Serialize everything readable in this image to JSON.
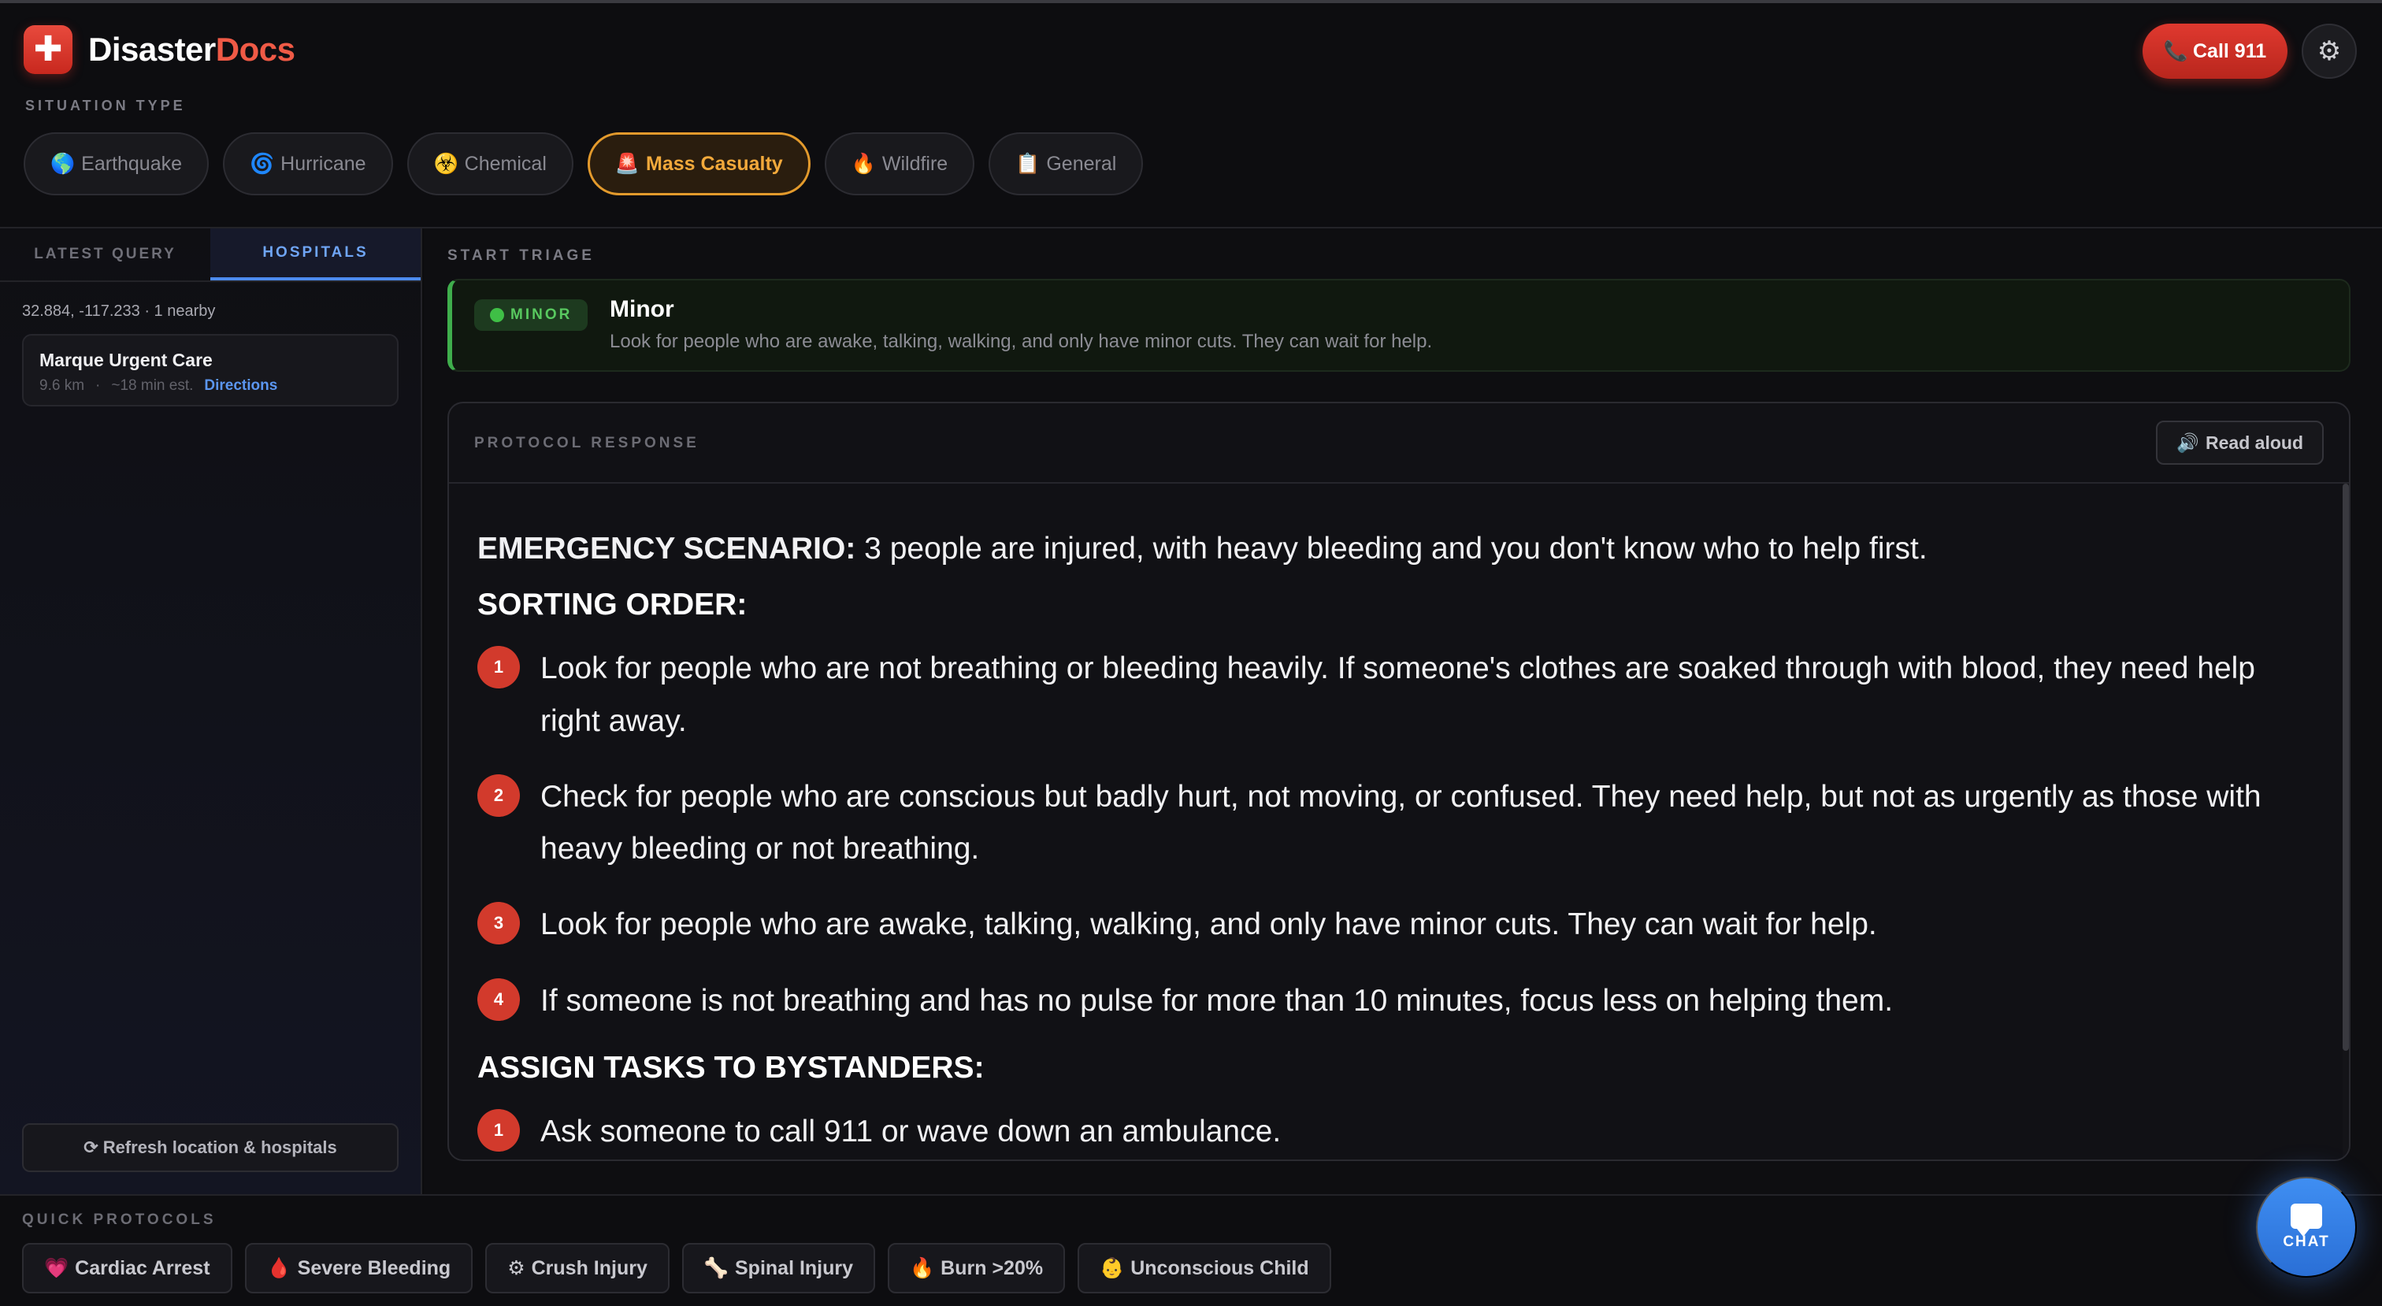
{
  "header": {
    "brand_icon": "✚",
    "brand_part1": "Disaster",
    "brand_part2": "Docs",
    "call_label": "Call 911",
    "call_icon": "📞",
    "settings_icon": "⚙"
  },
  "situation": {
    "label": "SITUATION TYPE",
    "items": [
      {
        "icon": "🌎",
        "label": "Earthquake"
      },
      {
        "icon": "🌀",
        "label": "Hurricane"
      },
      {
        "icon": "☣️",
        "label": "Chemical"
      },
      {
        "icon": "🚨",
        "label": "Mass Casualty"
      },
      {
        "icon": "🔥",
        "label": "Wildfire"
      },
      {
        "icon": "📋",
        "label": "General"
      }
    ],
    "active": "Mass Casualty"
  },
  "sidebar": {
    "tabs": [
      {
        "label": "LATEST QUERY"
      },
      {
        "label": "HOSPITALS"
      }
    ],
    "active_tab": "HOSPITALS",
    "coords": "32.884, -117.233 · 1 nearby",
    "hospital": {
      "name": "Marque Urgent Care",
      "distance": "9.6 km",
      "eta": "~18 min est.",
      "directions": "Directions",
      "separator": "·"
    },
    "refresh_icon": "⟳",
    "refresh_label": "Refresh location & hospitals"
  },
  "triage": {
    "label": "START TRIAGE",
    "badge": "MINOR",
    "title": "Minor",
    "desc": "Look for people who are awake, talking, walking, and only have minor cuts. They can wait for help.",
    "color": "#3fae4c"
  },
  "protocol": {
    "label": "PROTOCOL RESPONSE",
    "read_icon": "🔊",
    "read_label": "Read aloud",
    "scenario_heading": "EMERGENCY SCENARIO:",
    "scenario_text": " 3 people are injured, with heavy bleeding and you don't know who to help first.",
    "sorting_heading": "SORTING ORDER:",
    "steps": [
      {
        "num": "1",
        "text": "Look for people who are not breathing or bleeding heavily. If someone's clothes are soaked through with blood, they need help right away."
      },
      {
        "num": "2",
        "text": "Check for people who are conscious but badly hurt, not moving, or confused. They need help, but not as urgently as those with heavy bleeding or not breathing."
      },
      {
        "num": "3",
        "text": "Look for people who are awake, talking, walking, and only have minor cuts. They can wait for help."
      },
      {
        "num": "4",
        "text": "If someone is not breathing and has no pulse for more than 10 minutes, focus less on helping them."
      }
    ],
    "assign_heading": "ASSIGN TASKS TO BYSTANDERS:",
    "assign_steps": [
      {
        "num": "1",
        "text": "Ask someone to call 911 or wave down an ambulance."
      }
    ]
  },
  "quick": {
    "label": "QUICK PROTOCOLS",
    "items": [
      {
        "icon": "💗",
        "label": "Cardiac Arrest"
      },
      {
        "icon": "🩸",
        "label": "Severe Bleeding"
      },
      {
        "icon": "⚙",
        "label": "Crush Injury"
      },
      {
        "icon": "🦴",
        "label": "Spinal Injury"
      },
      {
        "icon": "🔥",
        "label": "Burn >20%"
      },
      {
        "icon": "👶",
        "label": "Unconscious Child"
      }
    ]
  },
  "chat": {
    "label": "CHAT"
  },
  "colors": {
    "accent_red": "#d23a2c",
    "accent_orange": "#e39a2c",
    "accent_blue": "#4d8bf0",
    "minor_green": "#3fae4c"
  }
}
